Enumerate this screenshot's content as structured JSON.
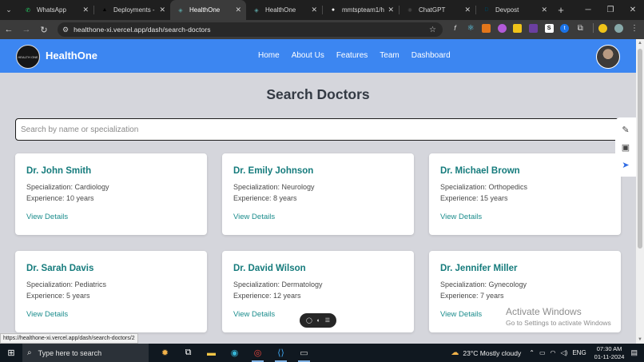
{
  "browser": {
    "tabs": [
      {
        "title": "WhatsApp",
        "favicon_color": "#25d366",
        "glyph": "✆"
      },
      {
        "title": "Deployments - V",
        "favicon_color": "#000000",
        "glyph": "▲"
      },
      {
        "title": "HealthOne",
        "favicon_color": "#5aa0a0",
        "glyph": "◈"
      },
      {
        "title": "HealthOne",
        "favicon_color": "#5aa0a0",
        "glyph": "◈"
      },
      {
        "title": "mmtspteam1/he",
        "favicon_color": "#ffffff",
        "glyph": "●"
      },
      {
        "title": "ChatGPT",
        "favicon_color": "#444444",
        "glyph": "✺"
      },
      {
        "title": "Devpost",
        "favicon_color": "#003e54",
        "glyph": "D"
      }
    ],
    "active_tab_index": 2,
    "url": "healthone-xi.vercel.app/dash/search-doctors",
    "extension_icons": [
      "f-icon",
      "react-icon",
      "fox-icon",
      "color-icon",
      "yellow-ext-icon",
      "dark-ext-icon",
      "s-icon",
      "blue-ext-icon",
      "puzzle-icon",
      "lizard-icon",
      "profile-icon",
      "menu-icon"
    ]
  },
  "app": {
    "brand": "HealthOne",
    "logo_text": "HEALTH ONE",
    "nav": [
      "Home",
      "About Us",
      "Features",
      "Team",
      "Dashboard"
    ],
    "page_title": "Search Doctors",
    "search_placeholder": "Search by name or specialization",
    "doctors": [
      {
        "name": "Dr. John Smith",
        "specialization": "Specialization: Cardiology",
        "experience": "Experience: 10 years",
        "cta": "View Details"
      },
      {
        "name": "Dr. Emily Johnson",
        "specialization": "Specialization: Neurology",
        "experience": "Experience: 8 years",
        "cta": "View Details"
      },
      {
        "name": "Dr. Michael Brown",
        "specialization": "Specialization: Orthopedics",
        "experience": "Experience: 15 years",
        "cta": "View Details"
      },
      {
        "name": "Dr. Sarah Davis",
        "specialization": "Specialization: Pediatrics",
        "experience": "Experience: 5 years",
        "cta": "View Details"
      },
      {
        "name": "Dr. David Wilson",
        "specialization": "Specialization: Dermatology",
        "experience": "Experience: 12 years",
        "cta": "View Details"
      },
      {
        "name": "Dr. Jennifer Miller",
        "specialization": "Specialization: Gynecology",
        "experience": "Experience: 7 years",
        "cta": "View Details"
      }
    ],
    "status_link": "https://healthone-xi.vercel.app/dash/search-doctors/2",
    "accent": "#3c86f1",
    "link_color": "#157b7c"
  },
  "windows": {
    "activate_title": "Activate Windows",
    "activate_sub": "Go to Settings to activate Windows",
    "taskbar_search": "Type here to search",
    "weather": "23°C  Mostly cloudy",
    "language": "ENG",
    "time": "07:30 AM",
    "date": "01-11-2024"
  }
}
